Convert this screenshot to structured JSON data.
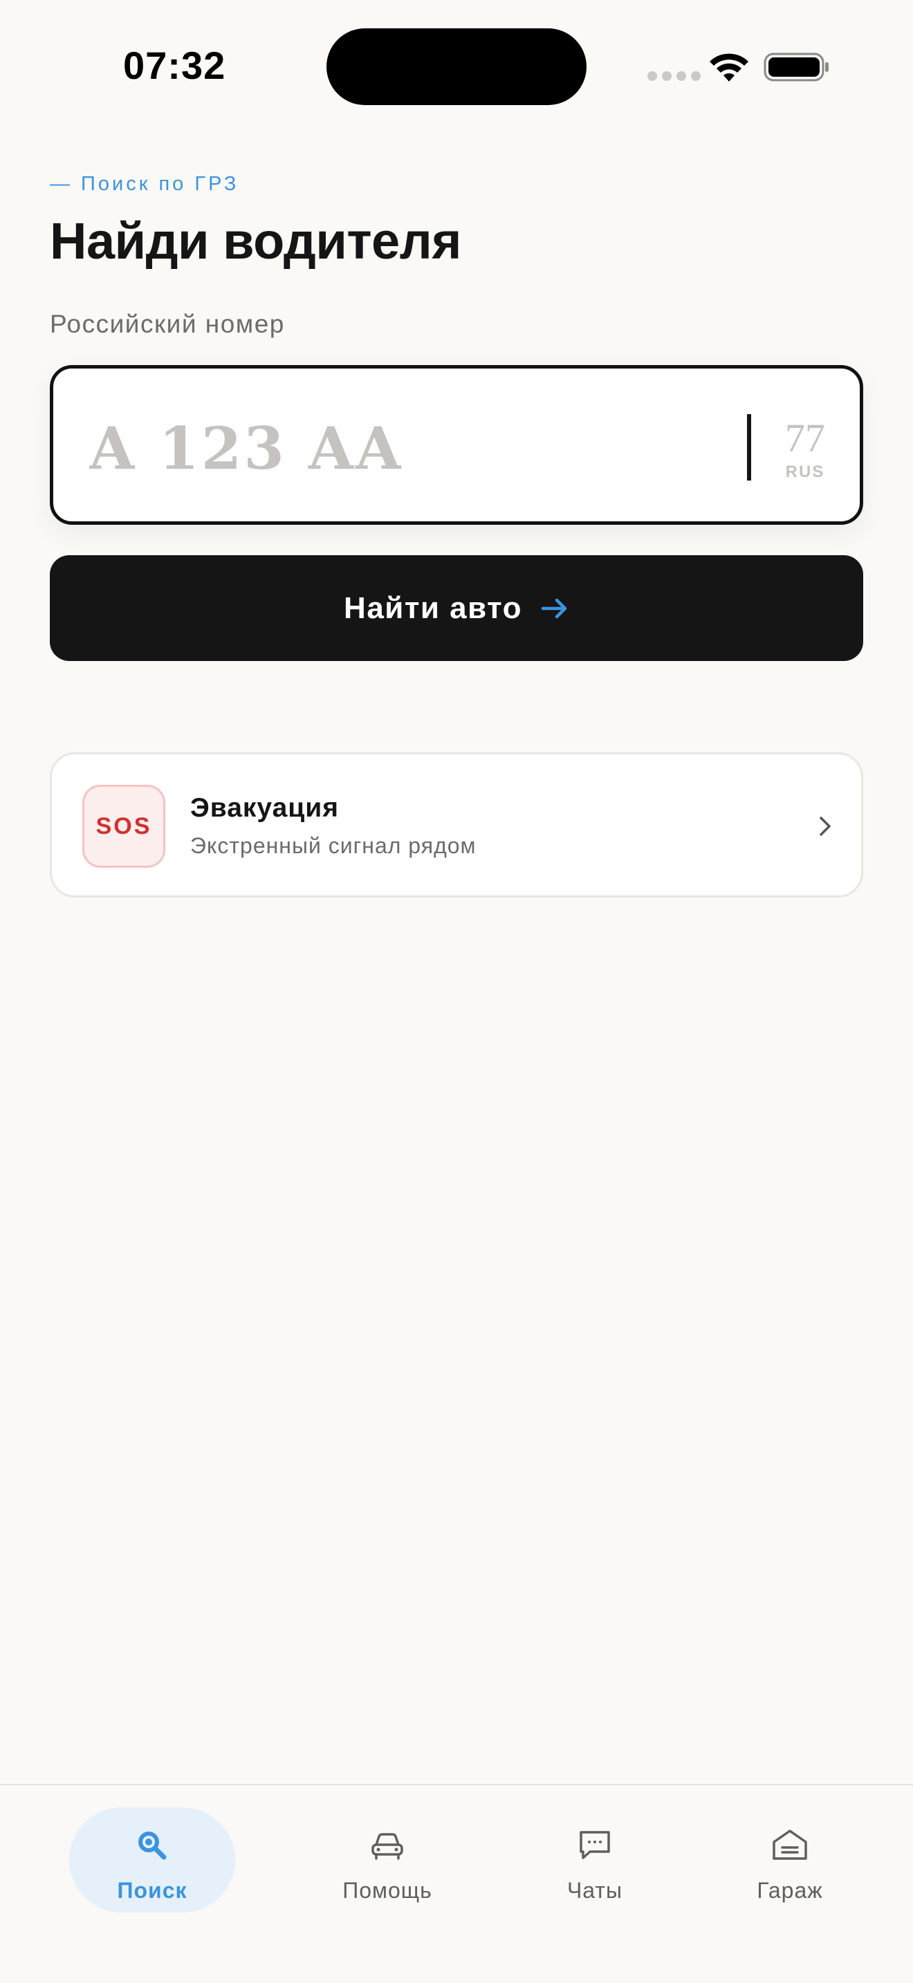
{
  "status_bar": {
    "time": "07:32"
  },
  "header": {
    "eyebrow": "— Поиск по ГРЗ",
    "title": "Найди водителя"
  },
  "plate_input": {
    "label": "Российский номер",
    "placeholder": "A 123 AA",
    "value": "",
    "region": "77",
    "country": "RUS"
  },
  "search_button": {
    "label": "Найти авто",
    "icon": "arrow-right-icon"
  },
  "sos_card": {
    "badge": "SOS",
    "title": "Эвакуация",
    "subtitle": "Экстренный сигнал рядом",
    "icon": "chevron-right-icon"
  },
  "tab_bar": {
    "active": "search",
    "items": [
      {
        "id": "search",
        "label": "Поиск",
        "icon": "search-icon"
      },
      {
        "id": "help",
        "label": "Помощь",
        "icon": "car-icon"
      },
      {
        "id": "chats",
        "label": "Чаты",
        "icon": "chat-icon"
      },
      {
        "id": "garage",
        "label": "Гараж",
        "icon": "garage-icon"
      }
    ]
  },
  "colors": {
    "background": "#FAF9F6",
    "accent": "#3A94E0",
    "primary_button": "#151515",
    "sos_red": "#D32F2F",
    "sos_badge_bg": "#FDEEEE"
  }
}
